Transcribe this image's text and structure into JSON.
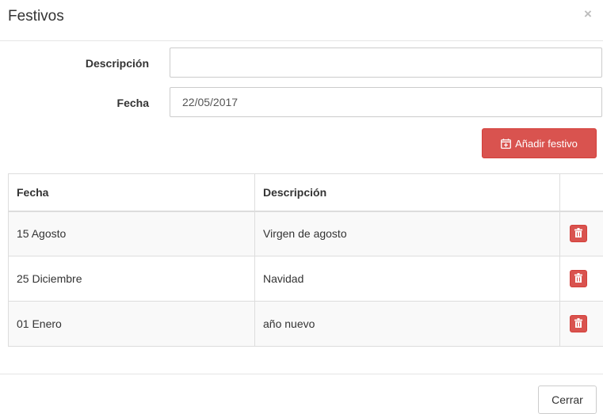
{
  "modal": {
    "title": "Festivos",
    "close_symbol": "×"
  },
  "form": {
    "description_label": "Descripción",
    "description_value": "",
    "date_label": "Fecha",
    "date_value": "22/05/2017",
    "add_button_label": "Añadir festivo",
    "add_button_icon": "calendar-plus-icon"
  },
  "table": {
    "headers": [
      "Fecha",
      "Descripción",
      ""
    ],
    "rows": [
      {
        "date": "15 Agosto",
        "description": "Virgen de agosto",
        "action_icon": "trash-icon"
      },
      {
        "date": "25 Diciembre",
        "description": "Navidad",
        "action_icon": "trash-icon"
      },
      {
        "date": "01 Enero",
        "description": "año nuevo",
        "action_icon": "trash-icon"
      }
    ]
  },
  "footer": {
    "close_button_label": "Cerrar"
  },
  "colors": {
    "danger": "#d9534f",
    "danger_border": "#d43f3a",
    "border": "#dddddd",
    "striped_row": "#f9f9f9"
  }
}
